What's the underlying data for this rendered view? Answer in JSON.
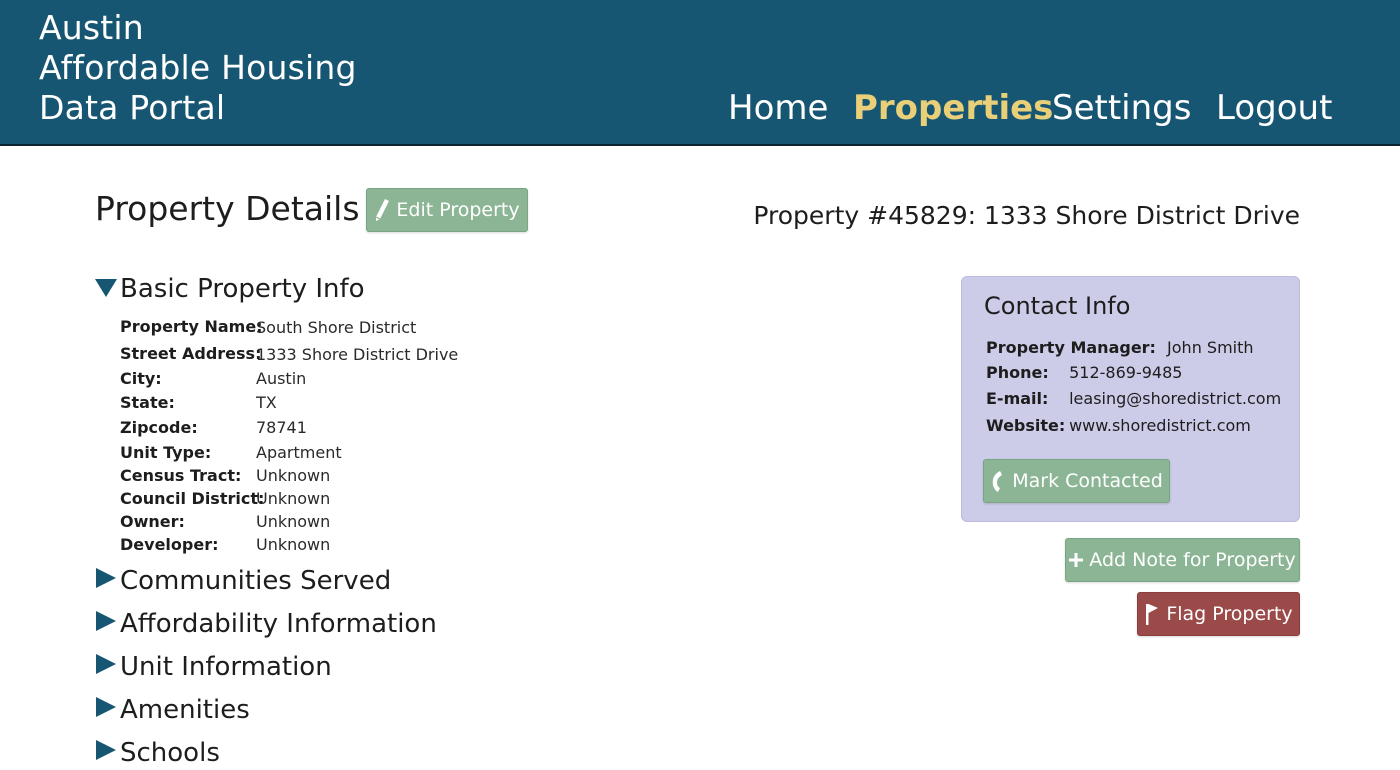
{
  "header": {
    "brand_lines": [
      "Austin",
      "Affordable Housing",
      "Data Portal"
    ],
    "nav": [
      {
        "label": "Home",
        "active": false
      },
      {
        "label": "Properties",
        "active": true
      },
      {
        "label": "Settings",
        "active": false
      },
      {
        "label": "Logout",
        "active": false
      }
    ],
    "bg_color": "#175672",
    "active_color": "#e8cf78"
  },
  "page": {
    "title": "Property Details",
    "edit_button": {
      "label": "Edit Property",
      "icon": "pencil-icon"
    },
    "property_heading": "Property #45829: 1333 Shore District Drive"
  },
  "basic_info": {
    "title": "Basic Property Info",
    "expanded": true,
    "fields": [
      {
        "key": "Property Name:",
        "value": "South Shore District"
      },
      {
        "key": "Street Address:",
        "value": "1333 Shore District Drive"
      },
      {
        "key": "City:",
        "value": "Austin"
      },
      {
        "key": "State:",
        "value": "TX"
      },
      {
        "key": "Zipcode:",
        "value": "78741"
      },
      {
        "key": "Unit Type:",
        "value": "Apartment"
      },
      {
        "key": "Census Tract:",
        "value": "Unknown"
      },
      {
        "key": "Council District:",
        "value": "Unknown"
      },
      {
        "key": "Owner:",
        "value": "Unknown"
      },
      {
        "key": "Developer:",
        "value": "Unknown"
      }
    ]
  },
  "collapsed_sections": [
    {
      "title": "Communities Served"
    },
    {
      "title": "Affordability Information"
    },
    {
      "title": "Unit Information"
    },
    {
      "title": "Amenities"
    },
    {
      "title": "Schools"
    }
  ],
  "contact": {
    "title": "Contact Info",
    "fields": [
      {
        "key": "Property Manager:",
        "value": "John Smith"
      },
      {
        "key": "Phone:",
        "value": "512-869-9485"
      },
      {
        "key": "E-mail:",
        "value": "leasing@shoredistrict.com"
      },
      {
        "key": "Website:",
        "value": "www.shoredistrict.com"
      }
    ],
    "mark_button": {
      "label": "Mark Contacted",
      "icon": "phone-icon"
    },
    "card_color": "#cccbe8"
  },
  "actions": {
    "add_note": {
      "label": "Add Note for Property",
      "icon": "plus-icon"
    },
    "flag": {
      "label": "Flag Property",
      "icon": "flag-icon"
    },
    "green_color": "#8cb595",
    "red_color": "#9b4a4a"
  }
}
